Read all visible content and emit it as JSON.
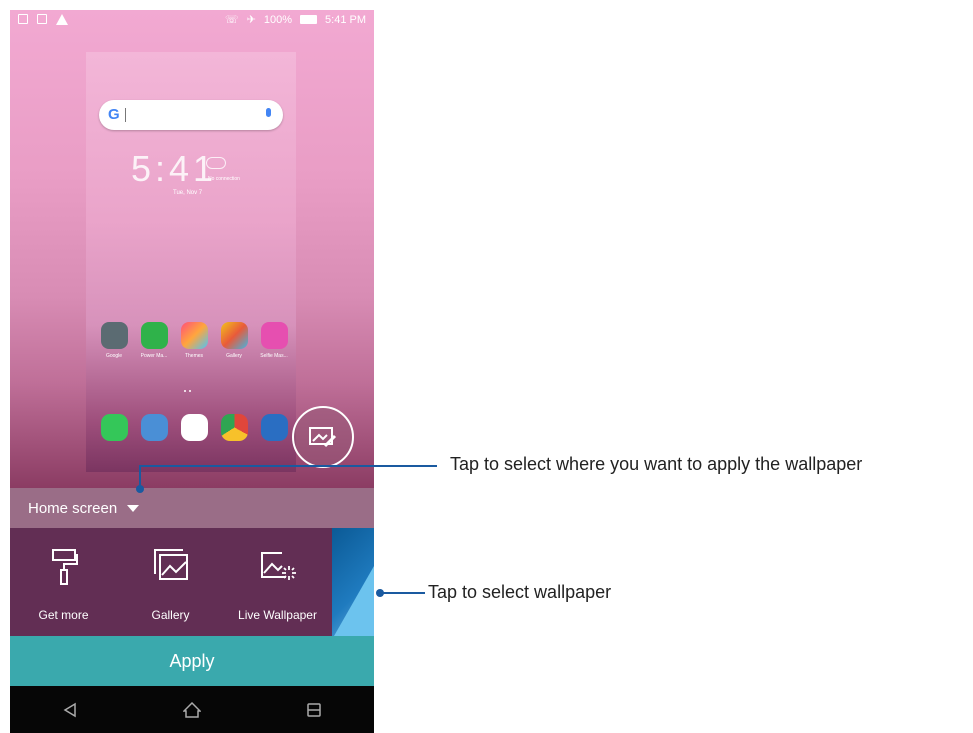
{
  "status_bar": {
    "battery": "100%",
    "time": "5:41 PM"
  },
  "preview": {
    "search_logo": "G",
    "clock": "5:41",
    "date": "Tue, Nov 7",
    "weather": "No connection",
    "apps": [
      {
        "label": "Google",
        "color": "#5b6b72"
      },
      {
        "label": "Power Ma...",
        "color": "#2fb24a"
      },
      {
        "label": "Themes",
        "color": "#ff6a3d"
      },
      {
        "label": "Gallery",
        "color": "#f2c21b"
      },
      {
        "label": "Selfie Mas...",
        "color": "#e64fb0"
      }
    ],
    "dock": [
      {
        "name": "phone-icon",
        "color": "#34c759"
      },
      {
        "name": "messages-icon",
        "color": "#4a8fd6"
      },
      {
        "name": "play-store-icon",
        "color": "#ffffff"
      },
      {
        "name": "chrome-icon",
        "color": "#ffffff"
      },
      {
        "name": "camera-icon",
        "color": "#2a6ec2"
      }
    ]
  },
  "selector": {
    "label": "Home screen"
  },
  "options": [
    {
      "label": "Get more",
      "icon": "paint-roller-icon"
    },
    {
      "label": "Gallery",
      "icon": "gallery-icon"
    },
    {
      "label": "Live Wallpaper",
      "icon": "live-wallpaper-icon"
    }
  ],
  "apply_label": "Apply",
  "callouts": {
    "apply_where": "Tap to select where you want to apply the wallpaper",
    "select_wallpaper": "Tap to select wallpaper"
  },
  "colors": {
    "accent": "#3aa9ad",
    "callout": "#1a5aa0",
    "options_bg": "#622e54"
  }
}
